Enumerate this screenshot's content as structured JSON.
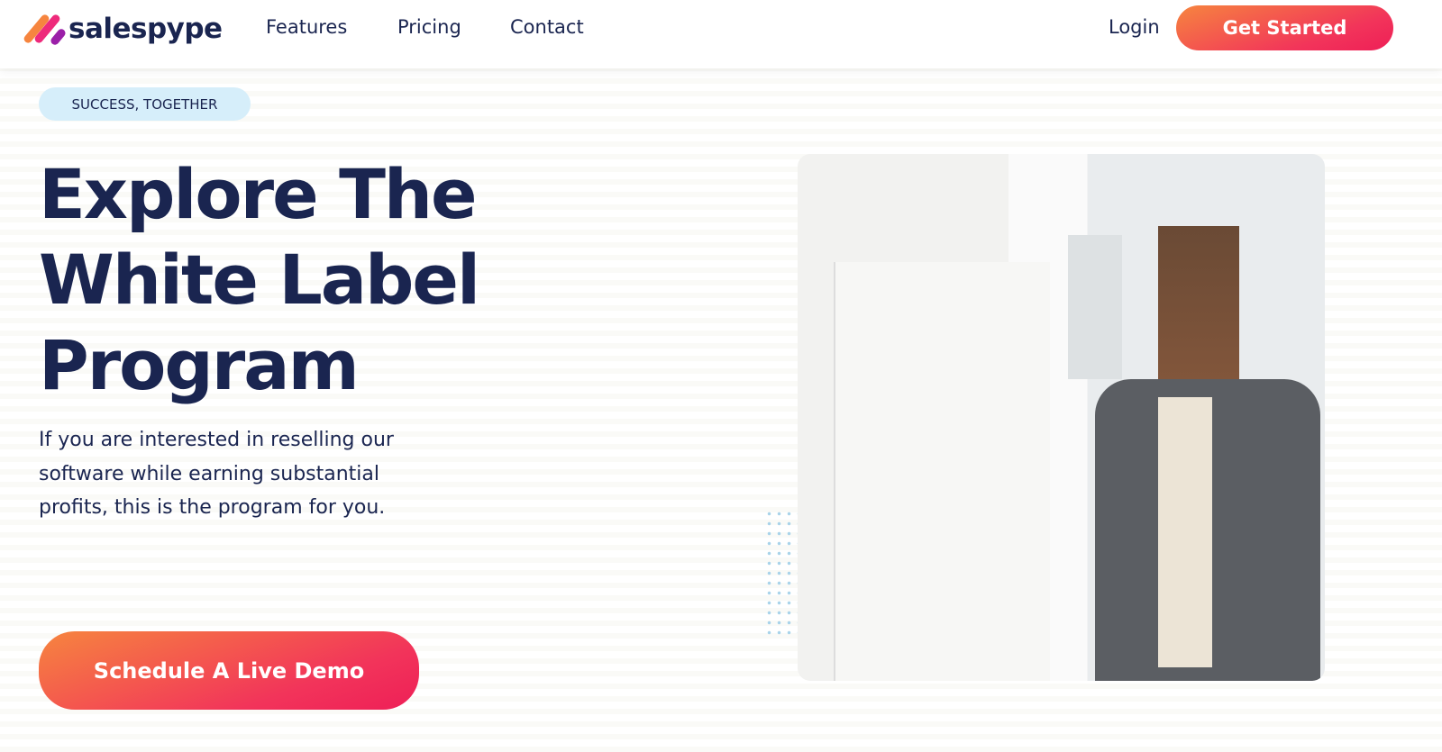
{
  "brand": {
    "name": "salespype",
    "logo_colors": [
      "#f6853f",
      "#ee2a7b",
      "#9b1fa8"
    ]
  },
  "nav": {
    "links": [
      "Features",
      "Pricing",
      "Contact"
    ],
    "login": "Login",
    "cta": "Get Started"
  },
  "hero": {
    "badge": "SUCCESS, TOGETHER",
    "title": "Explore The White Label Program",
    "description": "If you are interested in reselling our software while earning substantial profits, this is the program for you.",
    "cta": "Schedule A Live Demo",
    "image": "photo of a woman writing on a whiteboard"
  },
  "colors": {
    "accent_start": "#f6853f",
    "accent_end": "#f2345a",
    "text": "#1a2550",
    "badge_bg": "#d6eefa"
  }
}
